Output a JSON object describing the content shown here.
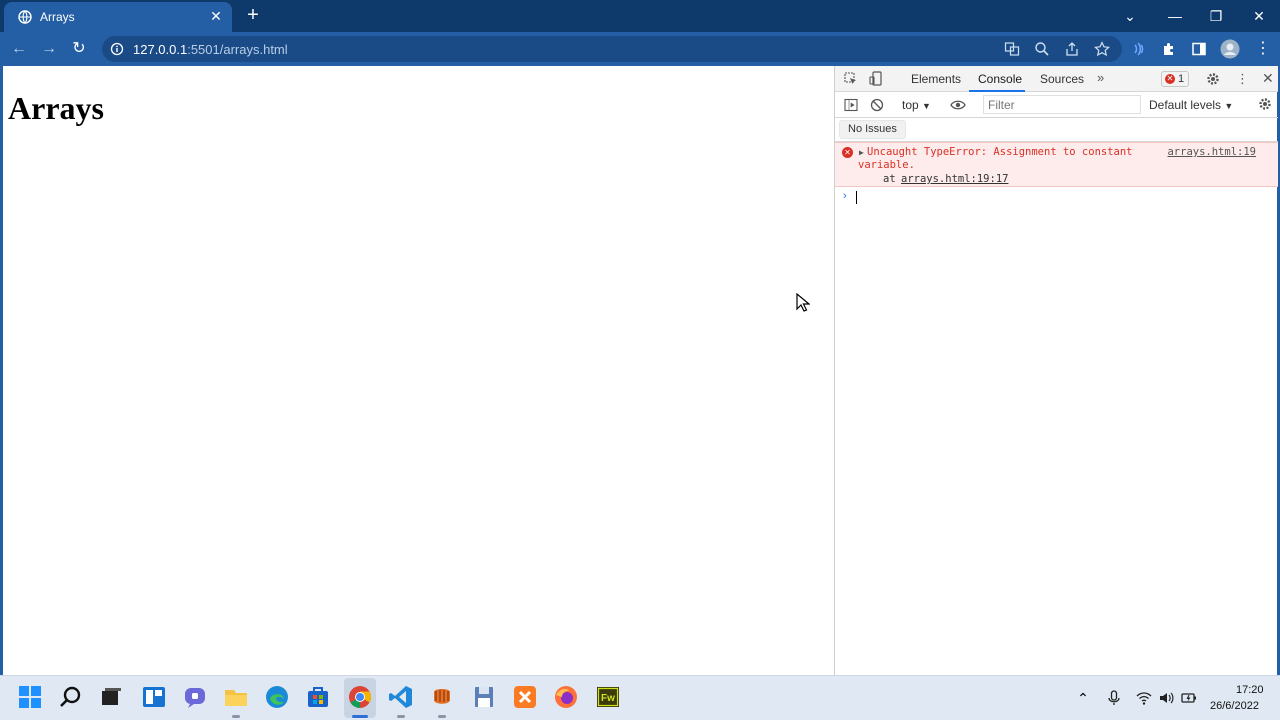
{
  "browser": {
    "tab_title": "Arrays",
    "url_host": "127.0.0.1",
    "url_rest": ":5501/arrays.html",
    "accent_color": "#245fa5",
    "titlebar_color": "#0e3a6b"
  },
  "page": {
    "heading": "Arrays"
  },
  "devtools": {
    "tabs": [
      "Elements",
      "Console",
      "Sources"
    ],
    "active_tab": "Console",
    "error_count": "1",
    "context": "top",
    "filter_placeholder": "Filter",
    "levels": "Default levels",
    "issues": "No Issues",
    "error": {
      "message_line1": "Uncaught TypeError: Assignment to constant",
      "message_line2": "variable.",
      "stack_prefix": "at",
      "stack_link": "arrays.html:19:17",
      "source": "arrays.html:19"
    }
  },
  "taskbar": {
    "time": "17:20",
    "date": "26/6/2022"
  }
}
